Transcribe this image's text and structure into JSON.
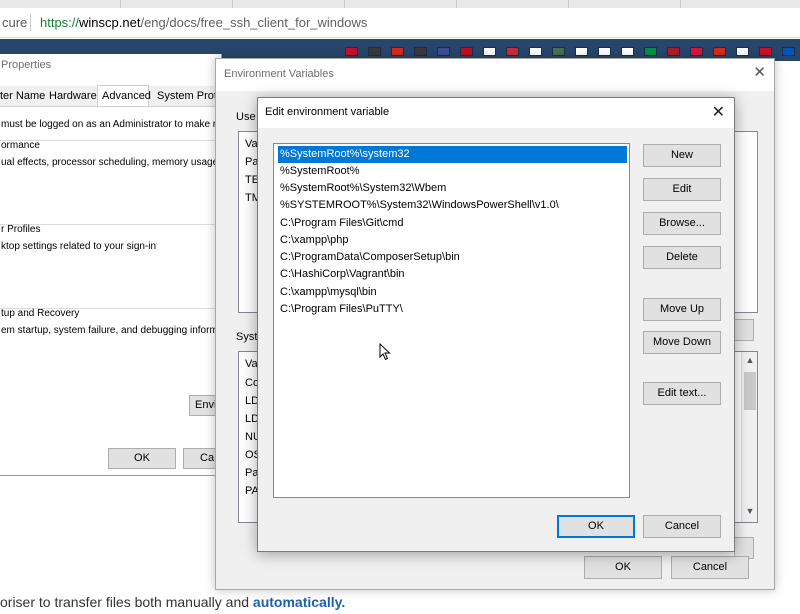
{
  "browser": {
    "secure_label": "cure",
    "url_scheme": "https://",
    "url_host": "winscp.net",
    "url_path": "/eng/docs/free_ssh_client_for_windows"
  },
  "website": {
    "bottom_text_prefix": "oriser to transfer files both manually and ",
    "bottom_text_bold": "automatically."
  },
  "system_properties": {
    "title": "Properties",
    "tabs": [
      "ter Name",
      "Hardware",
      "Advanced",
      "System Protect"
    ],
    "admin_note": "must be logged on as an Administrator to make mo",
    "performance_title": "ormance",
    "performance_desc": "ual effects, processor scheduling, memory usage, a",
    "profiles_title": "r Profiles",
    "profiles_desc": "ktop settings related to your sign-in",
    "startup_title": "tup and Recovery",
    "startup_desc": "em startup, system failure, and debugging informat",
    "env_button": "Envi",
    "ok": "OK",
    "cancel": "Ca"
  },
  "environment_variables": {
    "title": "Environment Variables",
    "user_label": "Use",
    "user_rows": [
      "Va",
      "Pa",
      "TE",
      "TM"
    ],
    "system_label": "Syste",
    "system_rows": [
      "Va",
      "Co",
      "LD",
      "LD",
      "NU",
      "OS",
      "Pa",
      "PA"
    ],
    "ok": "OK",
    "cancel": "Cancel"
  },
  "edit_dialog": {
    "title": "Edit environment variable",
    "paths": [
      "%SystemRoot%\\system32",
      "%SystemRoot%",
      "%SystemRoot%\\System32\\Wbem",
      "%SYSTEMROOT%\\System32\\WindowsPowerShell\\v1.0\\",
      "C:\\Program Files\\Git\\cmd",
      "C:\\xampp\\php",
      "C:\\ProgramData\\ComposerSetup\\bin",
      "C:\\HashiCorp\\Vagrant\\bin",
      "C:\\xampp\\mysql\\bin",
      "C:\\Program Files\\PuTTY\\"
    ],
    "selected_index": 0,
    "buttons": {
      "new": "New",
      "edit": "Edit",
      "browse": "Browse...",
      "delete": "Delete",
      "move_up": "Move Up",
      "move_down": "Move Down",
      "edit_text": "Edit text...",
      "ok": "OK",
      "cancel": "Cancel"
    }
  },
  "colors": {
    "selection": "#0078d7",
    "site_strip": "#27466c",
    "url_scheme": "#188038"
  }
}
